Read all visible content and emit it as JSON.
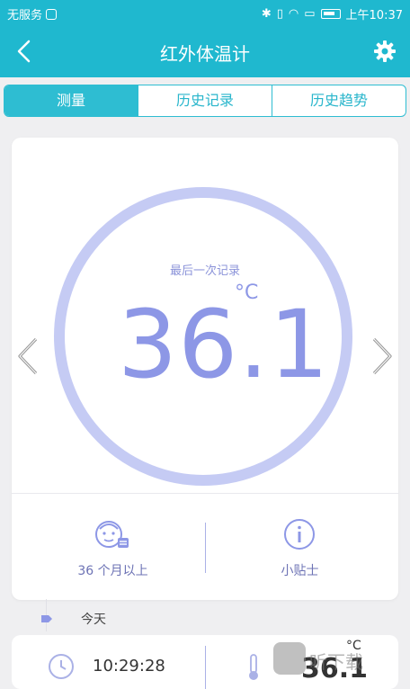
{
  "status_bar": {
    "left_text": "无服务",
    "time": "上午10:37"
  },
  "app_bar": {
    "title": "红外体温计"
  },
  "tabs": [
    {
      "label": "测量",
      "active": true
    },
    {
      "label": "历史记录",
      "active": false
    },
    {
      "label": "历史趋势",
      "active": false
    }
  ],
  "reading": {
    "label": "最后一次记录",
    "value": "36.1",
    "unit": "°C"
  },
  "actions": {
    "age_label": "36 个月以上",
    "tips_label": "小贴士"
  },
  "timeline": {
    "today_label": "今天",
    "record": {
      "time": "10:29:28",
      "temp": "36.1",
      "unit": "°C"
    }
  },
  "watermark": {
    "text": "听下载"
  },
  "colors": {
    "primary": "#1fb8cf",
    "accent": "#8d97e6",
    "ring": "#c5cbf4"
  }
}
